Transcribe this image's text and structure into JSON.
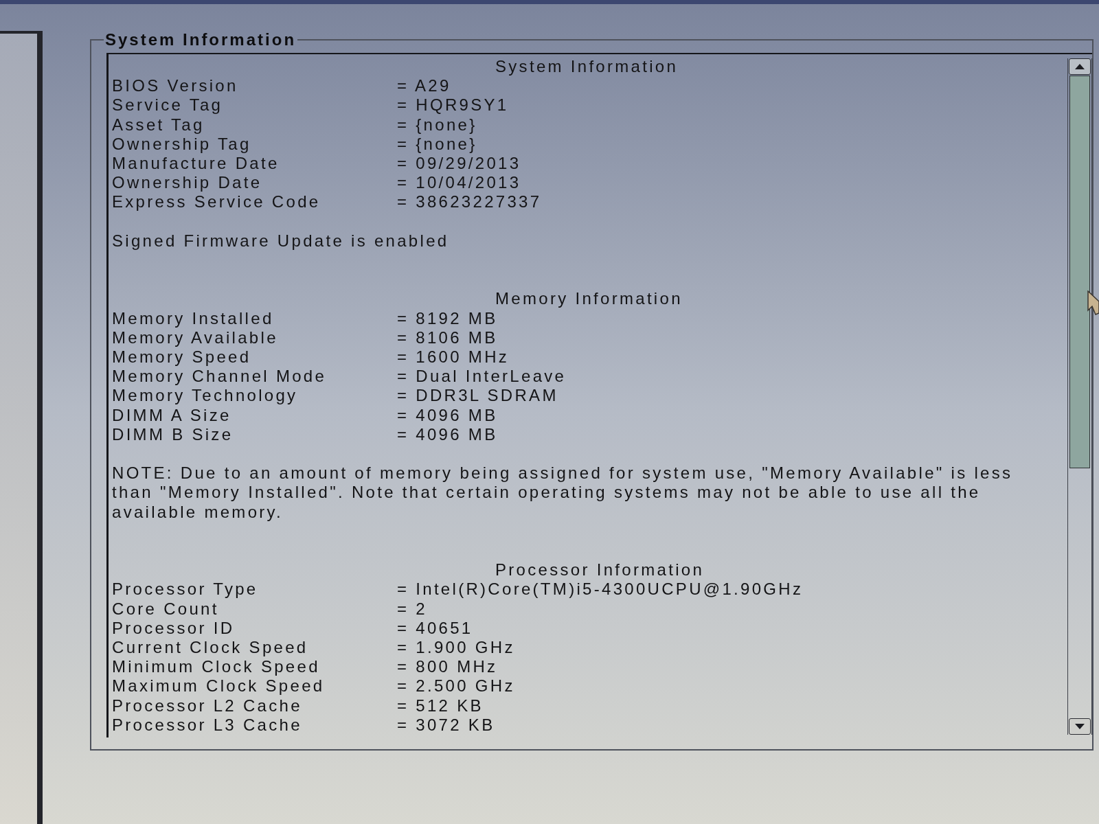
{
  "group_box": {
    "title": "System Information"
  },
  "sections": [
    {
      "heading": "System Information",
      "rows": [
        {
          "label": "BIOS Version",
          "value": "= A29"
        },
        {
          "label": "Service Tag",
          "value": "= HQR9SY1"
        },
        {
          "label": "Asset Tag",
          "value": "= {none}"
        },
        {
          "label": "Ownership Tag",
          "value": "= {none}"
        },
        {
          "label": "Manufacture Date",
          "value": "= 09/29/2013"
        },
        {
          "label": "Ownership Date",
          "value": "= 10/04/2013"
        },
        {
          "label": "Express Service Code",
          "value": "= 38623227337"
        }
      ],
      "note": "Signed Firmware Update is enabled"
    },
    {
      "heading": "Memory Information",
      "rows": [
        {
          "label": "Memory Installed",
          "value": "= 8192 MB"
        },
        {
          "label": "Memory Available",
          "value": "= 8106 MB"
        },
        {
          "label": "Memory Speed",
          "value": "= 1600 MHz"
        },
        {
          "label": "Memory Channel Mode",
          "value": "= Dual InterLeave"
        },
        {
          "label": "Memory Technology",
          "value": "= DDR3L SDRAM"
        },
        {
          "label": "DIMM A Size",
          "value": "= 4096 MB"
        },
        {
          "label": "DIMM B Size",
          "value": "= 4096 MB"
        }
      ],
      "note": "NOTE: Due to an amount of memory being assigned for system use, \"Memory Available\" is less than \"Memory Installed\". Note that certain operating systems may not be able to use all the available memory."
    },
    {
      "heading": "Processor Information",
      "rows": [
        {
          "label": "Processor Type",
          "value": "= Intel(R)Core(TM)i5-4300UCPU@1.90GHz"
        },
        {
          "label": "Core Count",
          "value": "= 2"
        },
        {
          "label": "Processor ID",
          "value": "= 40651"
        },
        {
          "label": "Current Clock Speed",
          "value": "= 1.900 GHz"
        },
        {
          "label": "Minimum Clock Speed",
          "value": "= 800 MHz"
        },
        {
          "label": "Maximum Clock Speed",
          "value": "= 2.500 GHz"
        },
        {
          "label": "Processor L2 Cache",
          "value": "= 512 KB"
        },
        {
          "label": "Processor L3 Cache",
          "value": "= 3072 KB"
        }
      ]
    }
  ]
}
